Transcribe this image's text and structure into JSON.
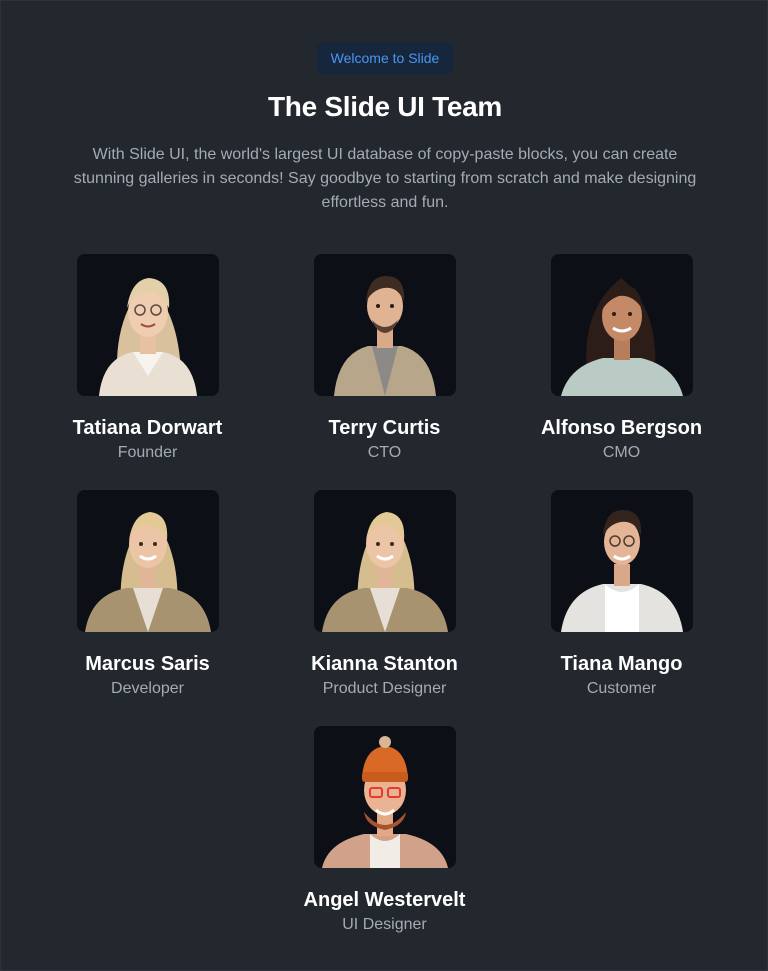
{
  "badge": {
    "label": "Welcome to Slide"
  },
  "header": {
    "title": "The Slide UI Team",
    "description": "With Slide UI, the world's largest UI database of copy-paste blocks, you can create stunning galleries in seconds! Say goodbye to starting from scratch and make designing effortless and fun."
  },
  "team": [
    {
      "name": "Tatiana Dorwart",
      "role": "Founder"
    },
    {
      "name": "Terry Curtis",
      "role": "CTO"
    },
    {
      "name": "Alfonso Bergson",
      "role": "CMO"
    },
    {
      "name": "Marcus Saris",
      "role": "Developer"
    },
    {
      "name": "Kianna Stanton",
      "role": "Product Designer"
    },
    {
      "name": "Tiana Mango",
      "role": "Customer"
    },
    {
      "name": "Angel Westervelt",
      "role": "UI Designer"
    }
  ],
  "colors": {
    "background": "#23272e",
    "accent": "#4b96f0",
    "badge_background": "#15263d",
    "photo_background": "#0c0f15"
  }
}
